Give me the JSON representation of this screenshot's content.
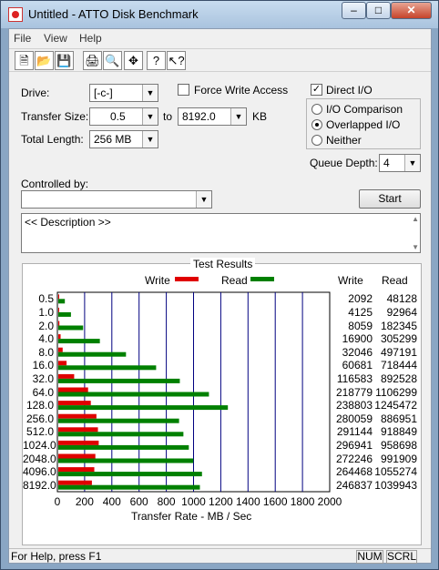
{
  "window": {
    "title": "Untitled - ATTO Disk Benchmark"
  },
  "menu": [
    "File",
    "View",
    "Help"
  ],
  "toolbar": {
    "icons": [
      "new-file-icon",
      "open-folder-icon",
      "save-disk-icon",
      "print-icon",
      "print-preview-icon",
      "move-cross-icon",
      "help-icon",
      "context-help-icon"
    ]
  },
  "settings": {
    "drive_label": "Drive:",
    "drive_value": "[-c-]",
    "force_write_label": "Force Write Access",
    "force_write_checked": false,
    "direct_io_label": "Direct I/O",
    "direct_io_checked": true,
    "transfer_size_label": "Transfer Size:",
    "transfer_from": "0.5",
    "to_label": "to",
    "transfer_to": "8192.0",
    "kb_label": "KB",
    "total_length_label": "Total Length:",
    "total_length_value": "256 MB",
    "io_options": [
      "I/O Comparison",
      "Overlapped I/O",
      "Neither"
    ],
    "io_selected": 1,
    "queue_depth_label": "Queue Depth:",
    "queue_depth_value": "4",
    "controlled_by_label": "Controlled by:",
    "controlled_by_value": "",
    "start_label": "Start",
    "description_text": "<< Description >>"
  },
  "results": {
    "title": "Test Results",
    "write_legend": "Write",
    "read_legend": "Read",
    "write_col": "Write",
    "read_col": "Read",
    "xlabel": "Transfer Rate - MB / Sec",
    "colors": {
      "write": "#e00000",
      "read": "#008000",
      "grid": "#000080"
    }
  },
  "chart_data": {
    "type": "bar",
    "categories": [
      "0.5",
      "1.0",
      "2.0",
      "4.0",
      "8.0",
      "16.0",
      "32.0",
      "64.0",
      "128.0",
      "256.0",
      "512.0",
      "1024.0",
      "2048.0",
      "4096.0",
      "8192.0"
    ],
    "series": [
      {
        "name": "Write",
        "values": [
          2092,
          4125,
          8059,
          16900,
          32046,
          60681,
          116583,
          218779,
          238803,
          280059,
          291144,
          296941,
          272246,
          264468,
          246837
        ]
      },
      {
        "name": "Read",
        "values": [
          48128,
          92964,
          182345,
          305299,
          497191,
          718444,
          892528,
          1106299,
          1245472,
          886951,
          918849,
          958698,
          991909,
          1055274,
          1039943
        ]
      }
    ],
    "xticks": [
      "0",
      "200",
      "400",
      "600",
      "800",
      "1000",
      "1200",
      "1400",
      "1600",
      "1800",
      "2000"
    ],
    "xlim": [
      0,
      2000
    ],
    "value_unit_divisor": 1000,
    "xlabel": "Transfer Rate - MB / Sec"
  },
  "status": {
    "help_text": "For Help, press F1",
    "num": "NUM",
    "scrl": "SCRL"
  }
}
